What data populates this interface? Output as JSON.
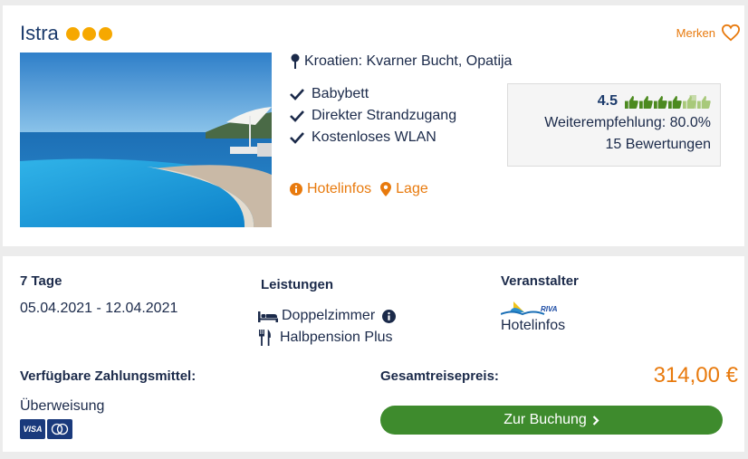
{
  "hotel": {
    "name": "Istra",
    "star_count": 3,
    "merken_label": "Merken",
    "location": "Kroatien: Kvarner Bucht, Opatija",
    "features": [
      "Babybett",
      "Direkter Strandzugang",
      "Kostenloses WLAN"
    ],
    "links": {
      "hotelinfos": "Hotelinfos",
      "lage": "Lage"
    },
    "rating": {
      "score": "4.5",
      "score_value": 4.5,
      "max": 6,
      "recommendation": "Weiterempfehlung: 80.0%",
      "reviews": "15 Bewertungen"
    }
  },
  "offer": {
    "duration": "7 Tage",
    "dates": "05.04.2021 - 12.04.2021",
    "leistungen_label": "Leistungen",
    "room": "Doppelzimmer",
    "board": "Halbpension Plus",
    "veranstalter_label": "Veranstalter",
    "veranstalter_link": "Hotelinfos",
    "payment_label": "Verfügbare Zahlungsmittel:",
    "payment_method": "Überweisung",
    "visa_label": "VISA",
    "total_label": "Gesamtreisepreis:",
    "price": "314,00 €",
    "book_label": "Zur Buchung",
    "riva_logo_text": "RIVA"
  },
  "colors": {
    "accent": "#e87a0d",
    "primary_text": "#1b3a6b",
    "button_green": "#3e8b2d",
    "star_yellow": "#f6a800",
    "thumb_green": "#4c8a1f",
    "thumb_light": "#a8c97a"
  },
  "icons": {
    "star": "star-icon",
    "heart": "heart-icon",
    "pin": "pin-icon",
    "check": "check-icon",
    "info": "info-icon",
    "map_marker": "map-marker-icon",
    "thumb": "thumbs-up-icon",
    "bed": "bed-icon",
    "cutlery": "cutlery-icon",
    "chevron": "chevron-right-icon"
  }
}
